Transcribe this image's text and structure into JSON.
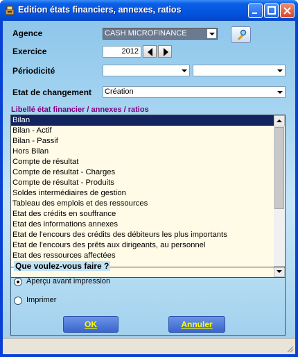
{
  "window": {
    "title": "Edition états financiers, annexes, ratios"
  },
  "form": {
    "agence": {
      "label": "Agence",
      "value": "CASH MICROFINANCE"
    },
    "exercice": {
      "label": "Exercice",
      "value": "2012"
    },
    "periodicite": {
      "label": "Périodicité",
      "value1": "",
      "value2": ""
    },
    "etat_changement": {
      "label": "Etat de changement",
      "value": "Création"
    }
  },
  "list": {
    "header": "Libellé état financier / annexes / ratios",
    "items": [
      "Bilan",
      "Bilan - Actif",
      "Bilan - Passif",
      "Hors Bilan",
      "Compte de résultat",
      "Compte de résultat - Charges",
      "Compte de résultat - Produits",
      "Soldes intermédiaires de gestion",
      "Tableau des emplois et des ressources",
      "Etat des crédits en souffrance",
      "Etat des informations annexes",
      "Etat de l'encours des crédits des débiteurs les plus importants",
      "Etat de l'encours des prêts aux dirigeants, au personnel",
      "Etat des ressources affectées"
    ],
    "selected_index": 0
  },
  "action_group": {
    "title": "Que voulez-vous faire ?",
    "options": [
      "Aperçu avant impression",
      "Imprimer"
    ],
    "selected": 0
  },
  "buttons": {
    "ok": "OK",
    "cancel": "Annuler"
  },
  "colors": {
    "title_bar": "#0554e0",
    "list_bg": "#fffbe6",
    "selection": "#13245f",
    "header_text": "#800080",
    "button_text": "#ffff00"
  }
}
